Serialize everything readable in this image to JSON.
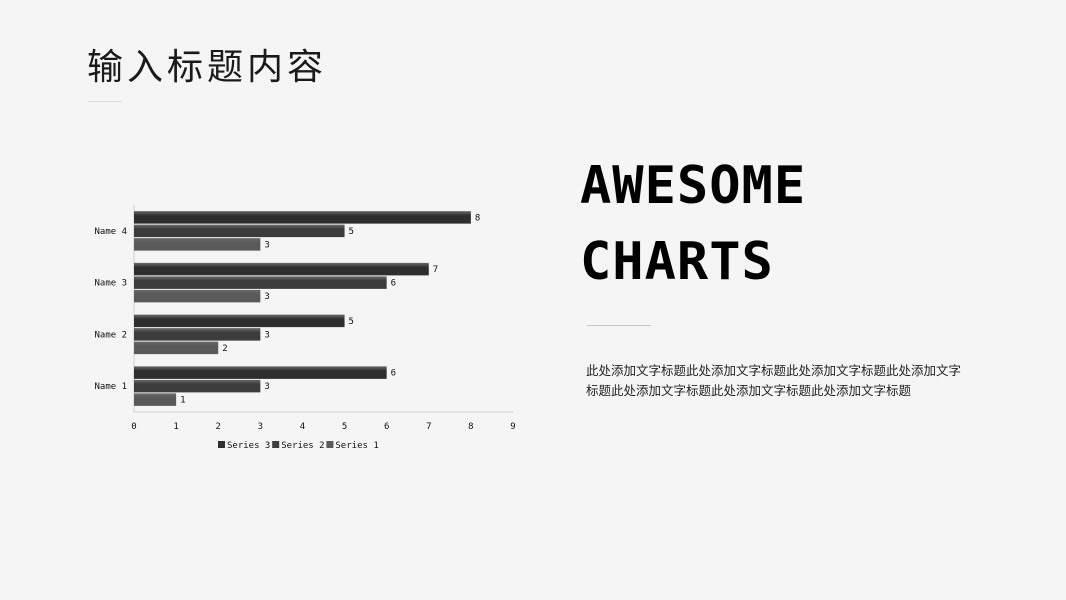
{
  "header": {
    "title": "输入标题内容"
  },
  "side": {
    "title_line1": "AWESOME",
    "title_line2": "CHARTS",
    "description": "此处添加文字标题此处添加文字标题此处添加文字标题此处添加文字标题此处添加文字标题此处添加文字标题此处添加文字标题"
  },
  "chart_data": {
    "type": "bar",
    "orientation": "horizontal",
    "title": "",
    "xlabel": "",
    "ylabel": "",
    "categories": [
      "Name 1",
      "Name 2",
      "Name 3",
      "Name 4"
    ],
    "series": [
      {
        "name": "Series 1",
        "values": [
          1,
          2,
          3,
          3
        ],
        "color": "#5a5a5a"
      },
      {
        "name": "Series 2",
        "values": [
          3,
          3,
          6,
          5
        ],
        "color": "#3c3c3c"
      },
      {
        "name": "Series 3",
        "values": [
          6,
          5,
          7,
          8
        ],
        "color": "#2e2e2e"
      }
    ],
    "xlim": [
      0,
      9
    ],
    "xticks": [
      0,
      1,
      2,
      3,
      4,
      5,
      6,
      7,
      8,
      9
    ],
    "grid": false,
    "data_labels": true,
    "legend": {
      "position": "bottom",
      "order": [
        "Series 3",
        "Series 2",
        "Series 1"
      ]
    }
  }
}
